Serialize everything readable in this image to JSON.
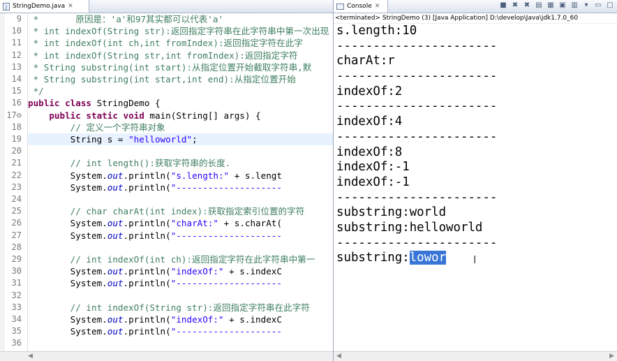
{
  "editor": {
    "tab_label": "StringDemo.java",
    "tab_icon": "J",
    "lines": [
      {
        "n": "9",
        "html": "<span class=\"c\"> *       原因是：'a'和97其实都可以代表'a'</span>"
      },
      {
        "n": "10",
        "html": "<span class=\"c\"> * int indexOf(String str):返回指定字符串在此字符串中第一次出现</span>"
      },
      {
        "n": "11",
        "html": "<span class=\"c\"> * int indexOf(int ch,int fromIndex):返回指定字符在此字</span>"
      },
      {
        "n": "12",
        "html": "<span class=\"c\"> * int indexOf(String str,int fromIndex):返回指定字符</span>"
      },
      {
        "n": "13",
        "html": "<span class=\"c\"> * String substring(int start):从指定位置开始截取字符串,默</span>"
      },
      {
        "n": "14",
        "html": "<span class=\"c\"> * String substring(int start,int end):从指定位置开始</span>"
      },
      {
        "n": "15",
        "html": "<span class=\"c\"> */</span>"
      },
      {
        "n": "16",
        "html": "<span class=\"k\">public class</span><span class=\"t\"> StringDemo {</span>"
      },
      {
        "n": "17⊖",
        "html": "<span class=\"t\">    </span><span class=\"k\">public static void</span><span class=\"t\"> main(String[] args) {</span>"
      },
      {
        "n": "18",
        "html": "<span class=\"c\">        // 定义一个字符串对象</span>"
      },
      {
        "n": "19",
        "html": "<span class=\"t\">        String s = </span><span class=\"s\">\"helloworld\"</span><span class=\"t\">;</span>",
        "current": true
      },
      {
        "n": "20",
        "html": ""
      },
      {
        "n": "21",
        "html": "<span class=\"c\">        // int length():获取字符串的长度.</span>"
      },
      {
        "n": "22",
        "html": "<span class=\"t\">        System.</span><span class=\"f\">out</span><span class=\"t\">.println(</span><span class=\"s\">\"s.length:\"</span><span class=\"t\"> + s.lengt</span>"
      },
      {
        "n": "23",
        "html": "<span class=\"t\">        System.</span><span class=\"f\">out</span><span class=\"t\">.println(</span><span class=\"s\">\"--------------------</span>"
      },
      {
        "n": "24",
        "html": ""
      },
      {
        "n": "25",
        "html": "<span class=\"c\">        // char charAt(int index):获取指定索引位置的字符</span>"
      },
      {
        "n": "26",
        "html": "<span class=\"t\">        System.</span><span class=\"f\">out</span><span class=\"t\">.println(</span><span class=\"s\">\"charAt:\"</span><span class=\"t\"> + s.charAt(</span>"
      },
      {
        "n": "27",
        "html": "<span class=\"t\">        System.</span><span class=\"f\">out</span><span class=\"t\">.println(</span><span class=\"s\">\"--------------------</span>"
      },
      {
        "n": "28",
        "html": ""
      },
      {
        "n": "29",
        "html": "<span class=\"c\">        // int indexOf(int ch):返回指定字符在此字符串中第一</span>"
      },
      {
        "n": "30",
        "html": "<span class=\"t\">        System.</span><span class=\"f\">out</span><span class=\"t\">.println(</span><span class=\"s\">\"indexOf:\"</span><span class=\"t\"> + s.indexC</span>"
      },
      {
        "n": "31",
        "html": "<span class=\"t\">        System.</span><span class=\"f\">out</span><span class=\"t\">.println(</span><span class=\"s\">\"--------------------</span>"
      },
      {
        "n": "32",
        "html": ""
      },
      {
        "n": "33",
        "html": "<span class=\"c\">        // int indexOf(String str):返回指定字符串在此字符</span>"
      },
      {
        "n": "34",
        "html": "<span class=\"t\">        System.</span><span class=\"f\">out</span><span class=\"t\">.println(</span><span class=\"s\">\"indexOf:\"</span><span class=\"t\"> + s.indexC</span>"
      },
      {
        "n": "35",
        "html": "<span class=\"t\">        System.</span><span class=\"f\">out</span><span class=\"t\">.println(</span><span class=\"s\">\"--------------------</span>"
      },
      {
        "n": "36",
        "html": ""
      }
    ]
  },
  "console": {
    "tab_label": "Console",
    "status": "<terminated> StringDemo (3) [Java Application] D:\\develop\\Java\\jdk1.7.0_60",
    "output": [
      "s.length:10",
      "----------------------",
      "charAt:r",
      "----------------------",
      "indexOf:2",
      "----------------------",
      "indexOf:4",
      "----------------------",
      "indexOf:8",
      "indexOf:-1",
      "indexOf:-1",
      "----------------------",
      "substring:world",
      "substring:helloworld",
      "----------------------"
    ],
    "last_prefix": "substring:",
    "last_selected": "lowor"
  }
}
